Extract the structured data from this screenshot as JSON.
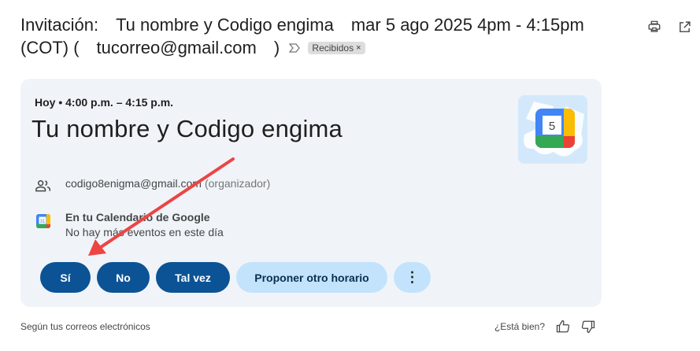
{
  "email": {
    "subject": {
      "prefix": "Invitación:",
      "event": "Tu nombre y Codigo engima",
      "datetime": "mar 5 ago 2025 4pm - 4:15pm",
      "tz_open": "(COT) (",
      "email": "tucorreo@gmail.com",
      "close": ")"
    },
    "label_chip": "Recibidos",
    "label_remove": "×"
  },
  "event_card": {
    "when": "Hoy • 4:00 p.m. – 4:15 p.m.",
    "title": "Tu nombre y Codigo engima",
    "calendar_art_day": "5",
    "organizer_email": "codigo8enigma@gmail.com",
    "organizer_note": "(organizador)",
    "calendar_heading": "En tu Calendario de Google",
    "calendar_status": "No hay más eventos en este día",
    "calendar_icon_day": "31"
  },
  "rsvp": {
    "yes": "Sí",
    "no": "No",
    "maybe": "Tal vez",
    "propose": "Proponer otro horario",
    "more": "⋮"
  },
  "footer": {
    "left": "Según tus correos electrónicos",
    "question": "¿Está bien?"
  },
  "colors": {
    "card_bg": "#f0f4f9",
    "button_primary": "#0b5395",
    "button_secondary": "#c2e3fb",
    "annotation_arrow": "#ee4444"
  }
}
